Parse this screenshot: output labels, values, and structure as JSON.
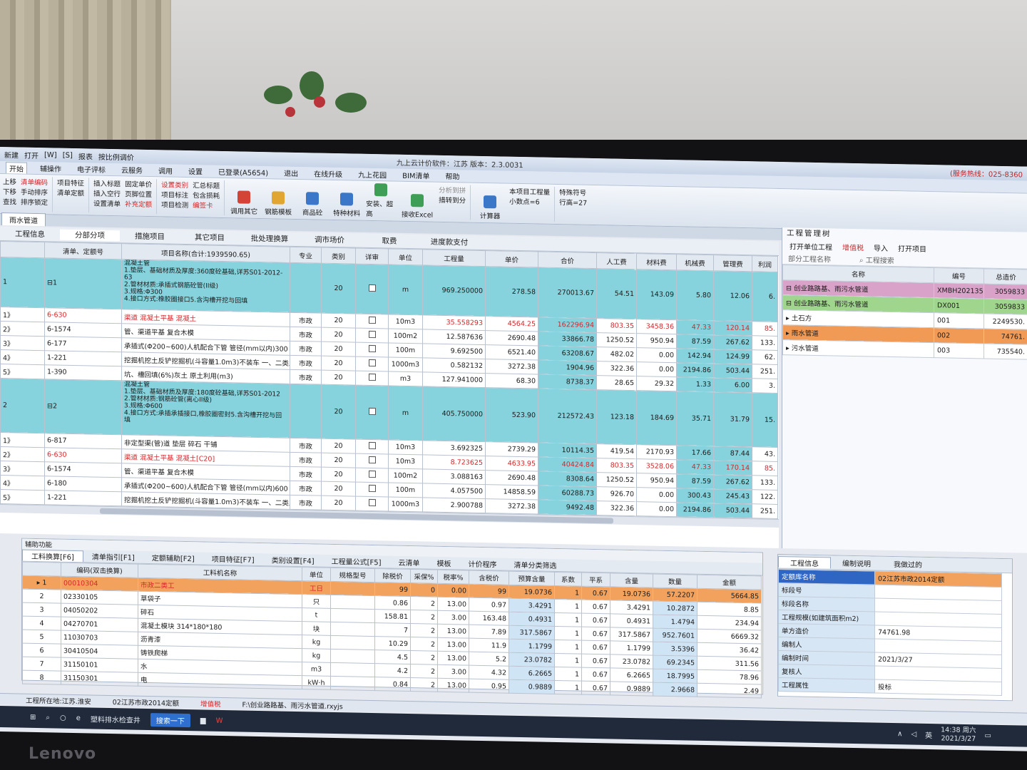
{
  "app": {
    "title": "九上云计价软件：江苏  版本：2.3.0031",
    "hotline": "(服务热线：025-8360",
    "quick": [
      "新建",
      "打开",
      "[W]",
      "[S]",
      "报表",
      "按比例调价"
    ]
  },
  "menu": [
    "开始",
    "辅操作",
    "电子评标",
    "云服务",
    "调用",
    "设置",
    "已登录(A5654)",
    "退出",
    "在线升级",
    "九上花园",
    "BIM清单",
    "帮助"
  ],
  "ribbon": {
    "g1": [
      "上移",
      "清单编码",
      "下移",
      "手动排序",
      "查找",
      "排序锁定"
    ],
    "g2": [
      "项目特征",
      "清单定额"
    ],
    "g3": [
      "插入标题",
      "固定单价",
      "插入空行",
      "页脚位置",
      "设置清单",
      "补充定额"
    ],
    "g4": [
      "设置类别",
      "汇总标题",
      "项目标注",
      "包含损耗",
      "项目检测",
      "编签卡"
    ],
    "big": [
      "调用其它",
      "钢筋模板",
      "商品砼",
      "特种材料",
      "安装、超高",
      "接收Excel",
      "分析到拼",
      "措转到分",
      "计算器",
      "本项目工程量",
      "小数点=6",
      "行高=27",
      "特殊符号"
    ]
  },
  "doc_tab": "雨水管道",
  "subtabs": [
    "工程信息",
    "分部分项",
    "措施项目",
    "其它项目",
    "批处理换算",
    "调市场价",
    "取费",
    "进度款支付"
  ],
  "main_table": {
    "headers": [
      "",
      "清单、定额号",
      "项目名称(合计:1939590.65)",
      "专业",
      "类别",
      "详审",
      "单位",
      "工程量",
      "单价",
      "合价",
      "人工费",
      "材料费",
      "机械费",
      "管理费",
      "利润"
    ],
    "rows": [
      {
        "type": "qd",
        "seq": "1",
        "code": "⊟1",
        "name": "混凝土管\n1.垫层、基础材质及厚度:360度砼基础,详苏S01-2012-63\n2.管材材质:承插式钢筋砼管(II级)\n3.规格:Φ300\n4.接口方式:橡胶圈接口5.含沟槽开挖与回填",
        "major": "",
        "cls": "20",
        "unit": "m",
        "qty": "969.250000",
        "price": "278.58",
        "total": "270013.67",
        "rg": "54.51",
        "cl": "143.09",
        "jx": "5.80",
        "gl": "12.06",
        "lr": "6."
      },
      {
        "type": "de",
        "seq": "1》",
        "code": "6-630",
        "name": "渠道 混凝土平基 混凝土",
        "major": "市政",
        "cls": "20",
        "unit": "10m3",
        "qty": "35.558293",
        "price": "4564.25",
        "total": "162296.94",
        "rg": "803.35",
        "cl": "3458.36",
        "jx": "47.33",
        "gl": "120.14",
        "lr": "85.",
        "red": true
      },
      {
        "type": "de",
        "seq": "2》",
        "code": "6-1574",
        "name": "管、渠道平基 复合木模",
        "major": "市政",
        "cls": "20",
        "unit": "100m2",
        "qty": "12.587636",
        "price": "2690.48",
        "total": "33866.78",
        "rg": "1250.52",
        "cl": "950.94",
        "jx": "87.59",
        "gl": "267.62",
        "lr": "133."
      },
      {
        "type": "de",
        "seq": "3》",
        "code": "6-177",
        "name": "承插式(Φ200~600)人机配合下管 管径(mm以内)300",
        "major": "市政",
        "cls": "20",
        "unit": "100m",
        "qty": "9.692500",
        "price": "6521.40",
        "total": "63208.67",
        "rg": "482.02",
        "cl": "0.00",
        "jx": "142.94",
        "gl": "124.99",
        "lr": "62."
      },
      {
        "type": "de",
        "seq": "4》",
        "code": "1-221",
        "name": "挖掘机挖土反铲挖掘机(斗容量1.0m3)不装车 一、二类土",
        "major": "市政",
        "cls": "20",
        "unit": "1000m3",
        "qty": "0.582132",
        "price": "3272.38",
        "total": "1904.96",
        "rg": "322.36",
        "cl": "0.00",
        "jx": "2194.86",
        "gl": "503.44",
        "lr": "251."
      },
      {
        "type": "de",
        "seq": "5》",
        "code": "1-390",
        "name": "坑、槽回填(6%)灰土 原土利用(m3)",
        "major": "市政",
        "cls": "20",
        "unit": "m3",
        "qty": "127.941000",
        "price": "68.30",
        "total": "8738.37",
        "rg": "28.65",
        "cl": "29.32",
        "jx": "1.33",
        "gl": "6.00",
        "lr": "3."
      },
      {
        "type": "qd",
        "seq": "2",
        "code": "⊟2",
        "name": "混凝土管\n1.垫层、基础材质及厚度:180度砼基础,详苏S01-2012\n2.管材材质:钢筋砼管(离心II级)\n3.规格:Φ600\n4.接口方式:承插承插接口,橡胶圈密封5.含沟槽开挖与回填",
        "major": "",
        "cls": "20",
        "unit": "m",
        "qty": "405.750000",
        "price": "523.90",
        "total": "212572.43",
        "rg": "123.18",
        "cl": "184.69",
        "jx": "35.71",
        "gl": "31.79",
        "lr": "15."
      },
      {
        "type": "de",
        "seq": "1》",
        "code": "6-817",
        "name": "非定型渠(管)道 垫层 碎石 干铺",
        "major": "市政",
        "cls": "20",
        "unit": "10m3",
        "qty": "3.692325",
        "price": "2739.29",
        "total": "10114.35",
        "rg": "419.54",
        "cl": "2170.93",
        "jx": "17.66",
        "gl": "87.44",
        "lr": "43."
      },
      {
        "type": "de",
        "seq": "2》",
        "code": "6-630",
        "name": "渠道 混凝土平基 混凝土[C20]",
        "major": "市政",
        "cls": "20",
        "unit": "10m3",
        "qty": "8.723625",
        "price": "4633.95",
        "total": "40424.84",
        "rg": "803.35",
        "cl": "3528.06",
        "jx": "47.33",
        "gl": "170.14",
        "lr": "85.",
        "red": true
      },
      {
        "type": "de",
        "seq": "3》",
        "code": "6-1574",
        "name": "管、渠道平基 复合木模",
        "major": "市政",
        "cls": "20",
        "unit": "100m2",
        "qty": "3.088163",
        "price": "2690.48",
        "total": "8308.64",
        "rg": "1250.52",
        "cl": "950.94",
        "jx": "87.59",
        "gl": "267.62",
        "lr": "133."
      },
      {
        "type": "de",
        "seq": "4》",
        "code": "6-180",
        "name": "承插式(Φ200~600)人机配合下管 管径(mm以内)600",
        "major": "市政",
        "cls": "20",
        "unit": "100m",
        "qty": "4.057500",
        "price": "14858.59",
        "total": "60288.73",
        "rg": "926.70",
        "cl": "0.00",
        "jx": "300.43",
        "gl": "245.43",
        "lr": "122."
      },
      {
        "type": "de",
        "seq": "5》",
        "code": "1-221",
        "name": "挖掘机挖土反铲挖掘机(斗容量1.0m3)不装车 一、二类土",
        "major": "市政",
        "cls": "20",
        "unit": "1000m3",
        "qty": "2.900788",
        "price": "3272.38",
        "total": "9492.48",
        "rg": "322.36",
        "cl": "0.00",
        "jx": "2194.86",
        "gl": "503.44",
        "lr": "251."
      }
    ]
  },
  "tree": {
    "title": "工程管理树",
    "tools": [
      "打开单位工程",
      "增值税",
      "导入",
      "打开项目"
    ],
    "search_label": "部分工程名称",
    "search_btn": "工程搜索",
    "headers": [
      "名称",
      "编号",
      "总造价"
    ],
    "rows": [
      {
        "style": "pink",
        "name": "⊟ 创业路路基、雨污水管道",
        "code": "XMBH202135624",
        "cost": "3059833"
      },
      {
        "style": "green",
        "name": "⊟ 创业路路基、雨污水管道",
        "code": "DX001",
        "cost": "3059833"
      },
      {
        "style": "plain",
        "name": "▸ 土石方",
        "code": "001",
        "cost": "2249530."
      },
      {
        "style": "orange",
        "name": "▸ 雨水管道",
        "code": "002",
        "cost": "74761."
      },
      {
        "style": "plain",
        "name": "▸ 污水管道",
        "code": "003",
        "cost": "735540."
      }
    ]
  },
  "aux": {
    "title": "辅助功能",
    "tabs": [
      "工料换算[F6]",
      "清单指引[F1]",
      "定额辅助[F2]",
      "项目特征[F7]",
      "类别设置[F4]",
      "工程量公式[F5]",
      "云清单",
      "模板",
      "计价程序",
      "清单分类筛选"
    ],
    "headers": [
      "",
      "编码(双击换算)",
      "工料机名称",
      "单位",
      "规格型号",
      "除税价",
      "采保%",
      "税率%",
      "含税价",
      "预算含量",
      "系数",
      "平系",
      "含量",
      "数量",
      "金额"
    ],
    "rows": [
      [
        "▸ 1",
        "00010304",
        "市政二类工",
        "工日",
        "",
        "99",
        "0",
        "0.00",
        "99",
        "19.0736",
        "1",
        "0.67",
        "19.0736",
        "57.2207",
        "5664.85"
      ],
      [
        "2",
        "02330105",
        "草袋子",
        "只",
        "",
        "0.86",
        "2",
        "13.00",
        "0.97",
        "3.4291",
        "1",
        "0.67",
        "3.4291",
        "10.2872",
        "8.85"
      ],
      [
        "3",
        "04050202",
        "碎石",
        "t",
        "",
        "158.81",
        "2",
        "3.00",
        "163.48",
        "0.4931",
        "1",
        "0.67",
        "0.4931",
        "1.4794",
        "234.94"
      ],
      [
        "4",
        "04270701",
        "混凝土模块 314*180*180",
        "块",
        "",
        "7",
        "2",
        "13.00",
        "7.89",
        "317.5867",
        "1",
        "0.67",
        "317.5867",
        "952.7601",
        "6669.32"
      ],
      [
        "5",
        "11030703",
        "沥青漆",
        "kg",
        "",
        "10.29",
        "2",
        "13.00",
        "11.9",
        "1.1799",
        "1",
        "0.67",
        "1.1799",
        "3.5396",
        "36.42"
      ],
      [
        "6",
        "30410504",
        "铸铁爬梯",
        "kg",
        "",
        "4.5",
        "2",
        "13.00",
        "5.2",
        "23.0782",
        "1",
        "0.67",
        "23.0782",
        "69.2345",
        "311.56"
      ],
      [
        "7",
        "31150101",
        "水",
        "m3",
        "",
        "4.2",
        "2",
        "3.00",
        "4.32",
        "6.2665",
        "1",
        "0.67",
        "6.2665",
        "18.7995",
        "78.96"
      ],
      [
        "8",
        "31150301",
        "电",
        "kW·h",
        "",
        "0.84",
        "2",
        "13.00",
        "0.95",
        "0.9889",
        "1",
        "0.67",
        "0.9889",
        "2.9668",
        "2.49"
      ]
    ]
  },
  "info": {
    "tabs": [
      "工程信息",
      "编制说明",
      "我做过的"
    ],
    "rows": [
      [
        "定额库名称",
        "02江苏市政2014定额"
      ],
      [
        "标段号",
        ""
      ],
      [
        "标段名称",
        ""
      ],
      [
        "工程规模(如建筑面积m2)",
        ""
      ],
      [
        "单方造价",
        "74761.98"
      ],
      [
        "编制人",
        ""
      ],
      [
        "编制时间",
        "2021/3/27"
      ],
      [
        "复核人",
        ""
      ],
      [
        "工程属性",
        "投标"
      ]
    ]
  },
  "status": {
    "location": "工程所在地:江苏.淮安",
    "quota": "02江苏市政2014定额",
    "tax": "增值税",
    "file": "F:\\创业路路基、雨污水管道.rxyjs"
  },
  "taskbar": {
    "app": "塑料排水检查井",
    "search": "搜索一下",
    "time": "14:38 周六",
    "date": "2021/3/27",
    "ime": "英"
  },
  "monitor_brand": "Lenovo"
}
